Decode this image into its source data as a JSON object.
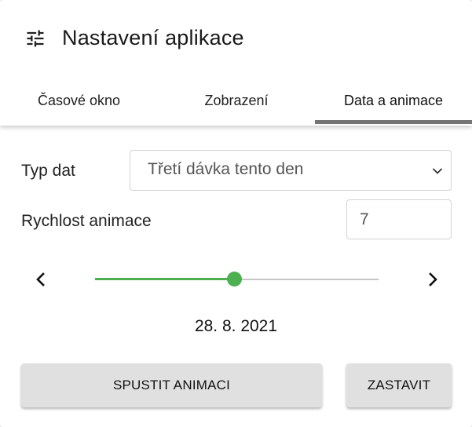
{
  "dialog": {
    "title": "Nastavení aplikace",
    "title_icon": "tune-icon"
  },
  "tabs": [
    {
      "label": "Časové okno",
      "active": false
    },
    {
      "label": "Zobrazení",
      "active": false
    },
    {
      "label": "Data a animace",
      "active": true
    }
  ],
  "form": {
    "data_type_label": "Typ dat",
    "data_type_value": "Třetí dávka tento den",
    "speed_label": "Rychlost animace",
    "speed_value": "7"
  },
  "timeline": {
    "prev_icon": "chevron-left-icon",
    "next_icon": "chevron-right-icon",
    "progress_fraction": 0.49,
    "current_date": "28. 8. 2021"
  },
  "buttons": {
    "start_label": "SPUSTIT ANIMACI",
    "stop_label": "ZASTAVIT"
  },
  "colors": {
    "accent": "#4caf50",
    "tab_indicator": "#757575",
    "button_bg": "#e0e0e0"
  }
}
